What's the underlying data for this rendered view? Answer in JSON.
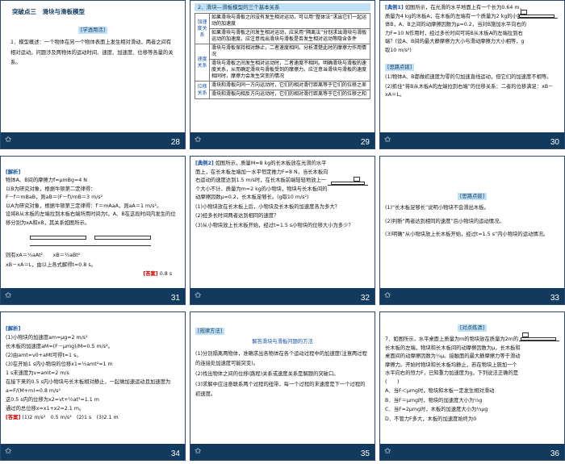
{
  "slides": [
    {
      "number": "28",
      "heading": "突破点三　滑块与滑板模型",
      "tag": "[学透用活]",
      "body": "1．模型概述：一个物体在另一个物体表面上发生相对滑动，两者之间有相对运动。问题涉及两物体的运动时间、速度、加速度、位移等各量的关系。"
    },
    {
      "number": "29",
      "table_title": "2．滑块—滑板模型的三个基本关系",
      "rows": [
        {
          "head": "加速度关系",
          "cells": [
            "如果滑块与滑板之间没有发生相对运动，可以用“整体法”求出它们一起运动的加速度",
            "如果滑块与滑板之间发生相对运动，应采用“隔离法”分别求出滑块与滑板运动的加速度。应注意找出滑块与滑板是否发生相对运动等隐含条件"
          ]
        },
        {
          "head": "速度关系",
          "cells": [
            "滑块与滑板保持相对静止，二者速度相同。分析清楚此时的摩擦力作用情况",
            "滑块与滑板之间发生相对运动时，二者速度不相同。明确滑块与滑板的速度关系，从而确定滑块与滑板受到的摩擦力。应注意当滑块与滑板的速度相同时，摩擦力会发生突变的情况"
          ]
        },
        {
          "head": "位移关系",
          "cells": [
            "滑块和滑板向同一方向运动时，它们的相对滑行距离等于它们的位移之差",
            "滑块和滑板向相反方向运动时，它们的相对滑行距离等于它们的位移之和"
          ]
        }
      ]
    },
    {
      "number": "30",
      "label": "[典例1]",
      "body": "如图所示，在光滑的水平地面上有一个长为0.64 m，质量为4 kg的木板A，在木板的左端有一个质量为2 kg的小物体B，A、B之间的动摩擦因数为μ=0.2，当对B施加水平向右的力F=10 N作用时，经过多长时间可将B从木板A的左端拉到右端？(设A、B间的最大静摩擦力大小与滑动摩擦力大小相等，g取10 m/s²)",
      "tag": "[思路点拨]",
      "hint1": "(1)物体A、B都做初速度为零的匀加速直线运动，但它们的加速度不相等。",
      "hint2": "(2)抓住“将B从木板A的左端拉到右端”的位移关系：二者的位移满足：xB－xA＝L。"
    },
    {
      "number": "31",
      "label": "[解析]",
      "body": "物体A、B间的摩擦力f=μmBg=4 N\n以B为研究对象，根据牛顿第二定律得：\nF－f＝mBaB，则aB＝(F－f)/mB＝3 m/s²\n以A为研究对象，根据牛顿第三定律得：f′＝mAaA，则aA＝1 m/s²。\n设将B从木板的左端拉到木板右端所用时间为t，A、B在这段时间内发生的位移分别为xA和xB，其关系如图所示。",
      "eq1": "则有xA＝½aAt²　　xB＝½aBt²",
      "eq2": "xB－xA＝L，由以上各式解得t=0.8 s。",
      "answer_tag": "[答案]",
      "answer": "0.8 s"
    },
    {
      "number": "32",
      "label": "[典例2]",
      "body": "如图所示，质量M=8 kg的长木板放在光滑的水平面上，在长木板左端加一水平恒定推力F=8 N，当长木板向右运动的速度达到1.5 m/s时，在长木板前端轻轻地放上一个大小不计、质量为m=2 kg的小物块，物块与长木板间的动摩擦因数μ=0.2，长木板足够长。(g取10 m/s²)",
      "q1": "(1)小物块放在长木板上后，小物块及长木板的加速度各为多大？",
      "q2": "(2)经多长时间两者达到相同的速度？",
      "q3": "(3)从小物块放上长木板开始，经过t=1.5 s小物块的位移大小为多少？"
    },
    {
      "number": "33",
      "tag": "[思路点拨]",
      "h1": "(1)“长木板足够长”说明小物块不会滑出木板。",
      "h2": "(2)判断“两者达到相同的速度”后小物块的运动情况。",
      "h3": "(3)明确“从小物块放上长木板开始，经过t=1.5 s”内小物块的运动情况。"
    },
    {
      "number": "34",
      "label": "[解析]",
      "body": "(1)小物块的加速度am=μg=2 m/s²\n长木板的加速度aM=(F－μmg)/M=0.5 m/s²。\n(2)由amt=v0+aMt可得t=1 s。\n(3)在开始1 s内小物块的位移x1=½amt²=1 m\n1 s末速度为v=amt=2 m/s\n在接下来的0.5 s内小物块与长木板相对静止，一起做加速运动且加速度为a=F/(M+m)=0.8 m/s²\n这0.5 s内的位移为x2=vt+½at²=1.1 m\n通过的总位移x=x1+x2=2.1 m。",
      "answer_tag": "[答案]",
      "answer": "(1)2 m/s²　0.5 m/s²　(2)1 s　(3)2.1 m"
    },
    {
      "number": "35",
      "tag": "[规律方法]",
      "title": "解答滑块与滑板问题的方法",
      "p1": "(1)分别隔离两物体，准确求出各物体在各个运动过程中的加速度(注意两过程的连接处加速度可能突变)。",
      "p2": "(2)找出物体之间的位移(路程)关系或速度关系是解题的突破口。",
      "p3": "(3)求解中应注意联系两个过程的纽带，每一个过程的末速度是下一个过程的初速度。"
    },
    {
      "number": "36",
      "tag": "[对点练清]",
      "body": "7．如图所示，水平桌面上质量为m的物块放在质量为2m的长木板的左端，物块和长木板间的动摩擦因数为μ，长木板和桌面间的动摩擦因数为¼μ。接触面的最大静摩擦力等于滑动摩擦力。开始时物块和长木板均静止，若在物块上施加一个水平向右的恒力F，已知重力加速度为g，下列说法正确的是　　　(　　)",
      "optA": "A．当F＜μmg时，物块和木板一定发生相对滑动",
      "optB": "B．当F＝μmg时，物块的加速度大小为⅓g",
      "optC": "C．当F=2μmg时，木板的加速度大小为⅓μg",
      "optD": "D．不管力F多大，木板的加速度始终为0"
    }
  ],
  "colors": {
    "footer": "#123a5e",
    "accent": "#1450a0",
    "tag_bg": "#bfe0f5",
    "answer": "#c00000"
  },
  "icons": {
    "footer_left": "star-icon"
  }
}
